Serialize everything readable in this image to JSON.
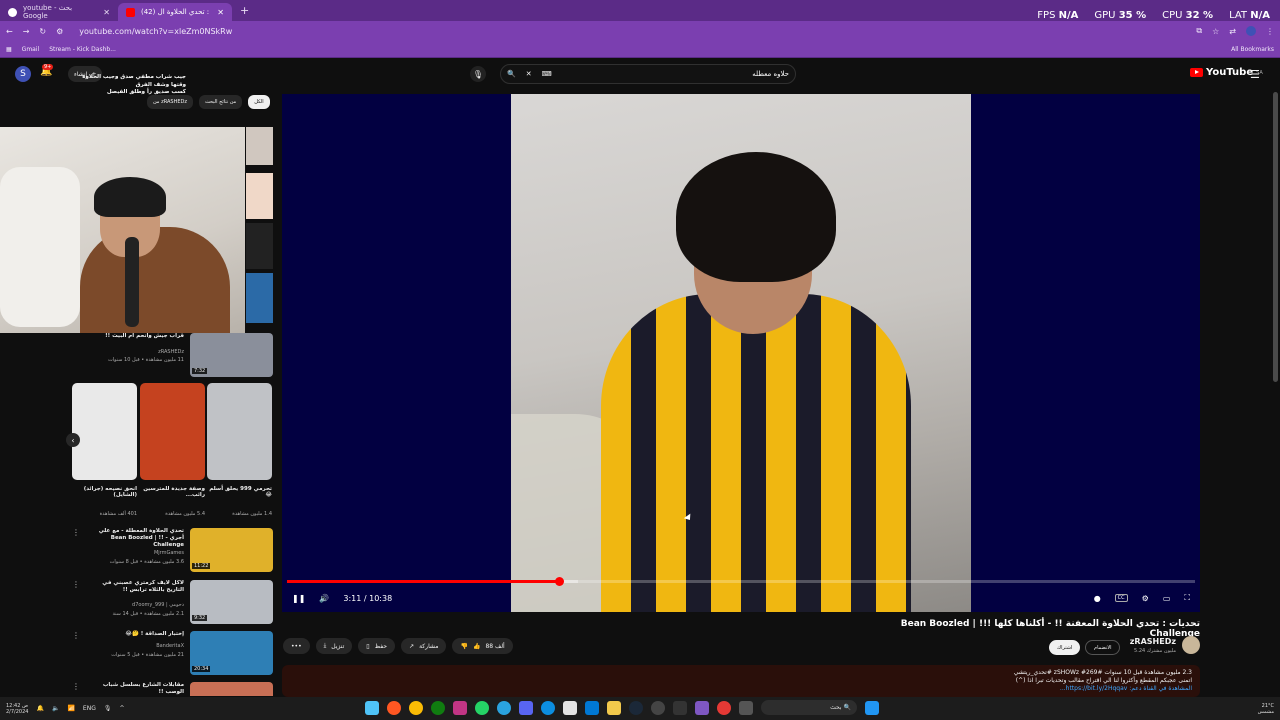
{
  "browser": {
    "tabs": [
      {
        "label": "youtube - بحث Google",
        "active": false
      },
      {
        "label": "(42) تحديات : تحدي الحلاوة ال...",
        "active": true
      }
    ],
    "url": "youtube.com/watch?v=xleZm0NSkRw",
    "bookmarks": [
      "Gmail",
      "Stream - Kick Dashb..."
    ],
    "all_bookmarks": "All Bookmarks"
  },
  "overlay": {
    "fps_label": "FPS",
    "fps_value": "N/A",
    "gpu_label": "GPU",
    "gpu_value": "35 %",
    "cpu_label": "CPU",
    "cpu_value": "32 %",
    "lat_label": "LAT",
    "lat_value": "N/A"
  },
  "header": {
    "avatar_letter": "S",
    "notif_count": "9+",
    "create_label": "إنشاء",
    "search_query": "حلاوه معطله",
    "logo_text": "YouTube",
    "logo_region": "SA"
  },
  "chat_overlay": {
    "line1": "جيب شراب مطفي صدق وجيب الحلاوة",
    "line2": "وقتها وشف الفرق",
    "line3": "كسب صديق رأ وطلق الفيصل"
  },
  "filter_chips": [
    "الكل",
    "من نتائج البحث",
    "من zRASHEDz"
  ],
  "player": {
    "time": "3:11 / 10:38",
    "progress": 0.3,
    "buffer": 0.32
  },
  "video": {
    "title": "تحديات : تحدي الحلاوة المعفنة !! - أكلناها كلها !!! | Bean Boozled Challenge",
    "channel": "zRASHEDz",
    "subscribers": "5.24 مليون مشترك",
    "join": "الانضمام",
    "subscribe": "اشتراك",
    "likes": "88 ألف",
    "share": "مشاركة",
    "save": "حفظ",
    "download": "تنزيل",
    "desc_line1": "2.3 مليون مشاهدة قبل 10 سنوات #zSHOWz #269 #تحدي_ريتشي",
    "desc_line2": "اتمنى عجبكم المقطع وأكثروا لنا الي اقتراح مقالب وتحديات تبرا اذا (^)",
    "desc_line3": "المشاهدة في القناة دعم: https://bit.ly/2Hqqav..."
  },
  "recommendations": [
    {
      "title": "قراب جيش وأنحم أم البيت !!",
      "channel": "zRASHEDz",
      "views": "11 مليون مشاهدة • قبل 10 سنوات",
      "duration": "7:32",
      "color": "#8a8f9b"
    },
    {
      "title": "تحدي الحلاوة المعطلة - مع علي أجري - !! | Bean Boozled Challenge",
      "channel": "MjrmGames",
      "views": "3.6 مليون مشاهدة • قبل 8 سنوات",
      "duration": "11:22",
      "color": "#e0b12a"
    },
    {
      "title": "لاكل لايف كرمتري عصبني في التاريخ بالثلاه ترابس !!",
      "channel": "d7oomy_999 | دحومي",
      "views": "2.1 مليون مشاهدة • قبل 14 سنة",
      "duration": "9:32",
      "color": "#b8bcc2"
    },
    {
      "title": "إختبار الصداقة ! 🤔😂",
      "channel": "BanderitaX",
      "views": "21 مليون مشاهدة • قبل 5 سنوات",
      "duration": "20:34",
      "color": "#2e7fb5"
    },
    {
      "title": "مقابلات الشارع بسلسل شباب الوصب !!",
      "channel": "",
      "views": "",
      "duration": "",
      "color": "#c86f55"
    }
  ],
  "shorts": [
    {
      "title": "تحرمي 999 يحلق أسلم 😂",
      "views": "1.4 مليون مشاهدة",
      "color": "#c0c2c6"
    },
    {
      "title": "وصفة جديدة للمترسين رائب...",
      "views": "5.4 مليون مشاهدة",
      "color": "#c5421f"
    },
    {
      "title": "انحق نصيحه (جرائد)(الشايل)",
      "views": "401 ألف مشاهدة",
      "color": "#e9e9e9"
    }
  ],
  "taskbar": {
    "search_label": "بحث",
    "lang": "ENG",
    "temp": "21°C",
    "weather": "مشمس",
    "time": "12:42 ص",
    "date": "2/7/2024"
  }
}
